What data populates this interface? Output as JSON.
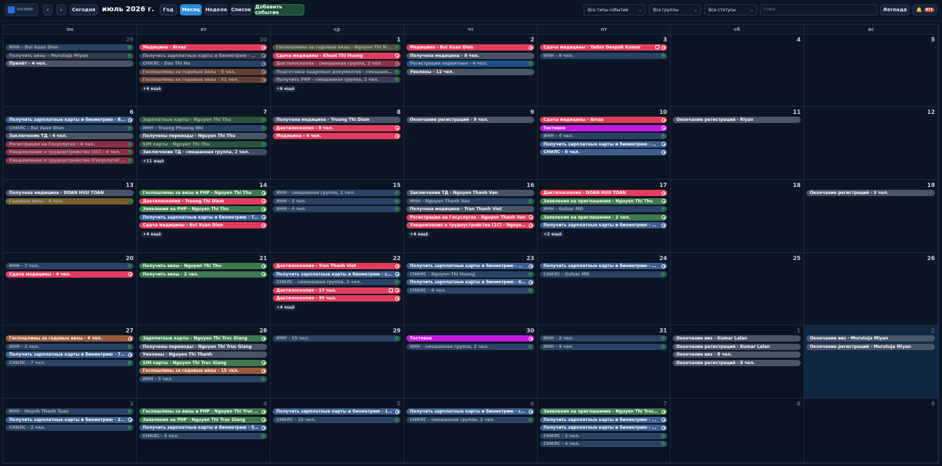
{
  "toolbar": {
    "logo_text": "DVCRMM",
    "prev_label": "‹",
    "next_label": "›",
    "today_label": "Сегодня",
    "title": "июль 2026 г.",
    "views": [
      "Год",
      "Месяц",
      "Неделя",
      "Список"
    ],
    "active_view": "Месяц",
    "add_event_label": "Добавить событие",
    "filter_types": "Все типы событий",
    "filter_groups": "Все группы",
    "filter_statuses": "Все статусы",
    "search_placeholder": "Поиск",
    "legend_label": "Легенда",
    "notifications_count": "471"
  },
  "weekdays": [
    "пн",
    "вт",
    "ср",
    "чт",
    "пт",
    "сб",
    "вс"
  ],
  "colors": {
    "background": "#0b1524",
    "today": "#102744",
    "accent_active": "#2e8bd8",
    "add_button": "#1e4d3a"
  },
  "weeks": [
    [
      {
        "day": "29",
        "other": true,
        "events": [
          {
            "t": "ИНН – Bui Xuan Dien",
            "c": "blue",
            "s": "ok",
            "dim": true
          },
          {
            "t": "Получить визы – Murutuja Miyan",
            "c": "gray",
            "s": "ok",
            "dim": true
          },
          {
            "t": "Прилёт - 4 чел.",
            "c": "gray",
            "s": ""
          }
        ]
      },
      {
        "day": "30",
        "other": true,
        "events": [
          {
            "t": "Медицина - Arvaz",
            "c": "red",
            "s": "pend"
          },
          {
            "t": "Получить зарплатные карты и биометрию - Dao ...",
            "c": "gray",
            "s": "pend",
            "dim": true
          },
          {
            "t": "СНИЛС - Dao Thi Ha",
            "c": "blue",
            "s": "pend",
            "dim": true
          },
          {
            "t": "Госпошлины за годовые визы - 5 чел.",
            "c": "brown",
            "s": "pend",
            "dim": true
          },
          {
            "t": "Госпошлины за годовые визы - 51 чел.",
            "c": "brown",
            "s": "pend",
            "dim": true
          }
        ],
        "more": "+4 ещё"
      },
      {
        "day": "1",
        "events": [
          {
            "t": "Госпошлины за годовые визы - Nguyen Thi Nhai",
            "c": "olive",
            "s": "ok",
            "dim": true
          },
          {
            "t": "Сдача медицины - Khuat Thi Huong",
            "c": "red",
            "s": "pend"
          },
          {
            "t": "Дактилоскопия - смешанная группа, 2 чел.",
            "c": "red",
            "s": "pend",
            "dim": true
          },
          {
            "t": "Подготовка кадровых документов - смешанная...",
            "c": "gray",
            "s": "ok",
            "dim": true
          },
          {
            "t": "Получить РНР - смешанная группа, 2 чел.",
            "c": "plum",
            "s": "ok",
            "dim": true
          }
        ],
        "more": "+6 ещё"
      },
      {
        "day": "2",
        "events": [
          {
            "t": "Медицина - Bui Xuan Dien",
            "c": "red",
            "s": "pend"
          },
          {
            "t": "Получена медицина - 8 чел.",
            "c": "gray",
            "s": ""
          },
          {
            "t": "Регистрация первичная - 4 чел.",
            "c": "lblue",
            "s": "ok",
            "dim": true
          },
          {
            "t": "Уволены - 12 чел.",
            "c": "gray",
            "s": ""
          }
        ]
      },
      {
        "day": "3",
        "events": [
          {
            "t": "Сдача медицины - Yadav Deepak Kumar",
            "c": "red",
            "s": "pend",
            "sq": true
          },
          {
            "t": "ИНН - 8 чел.",
            "c": "blue",
            "s": "ok",
            "dim": true
          }
        ]
      },
      {
        "day": "4",
        "events": []
      },
      {
        "day": "5",
        "events": []
      }
    ],
    [
      {
        "day": "6",
        "events": [
          {
            "t": "Получить зарплатные карты и биометрию - Bui ...",
            "c": "blue",
            "s": "pend"
          },
          {
            "t": "СНИЛС - Bui Xuan Dien",
            "c": "blue",
            "s": "ok",
            "dim": true
          },
          {
            "t": "Заключение ТД - 4 чел.",
            "c": "gray",
            "s": ""
          },
          {
            "t": "Регистрация на Госуслугах - 4 чел.",
            "c": "red",
            "s": "ok",
            "dim": true
          },
          {
            "t": "Уведомление о трудоустройстве (1С) - 4 чел.",
            "c": "red",
            "s": "ok",
            "dim": true
          },
          {
            "t": "Уведомление о трудоустройстве (Госуслуги) - 4 ...",
            "c": "red",
            "s": "ok",
            "dim": true
          }
        ]
      },
      {
        "day": "7",
        "events": [
          {
            "t": "Зарплатные карты - Nguyen Thi Thu",
            "c": "green",
            "s": "ok",
            "dim": true
          },
          {
            "t": "ИНН - Truong Phuong Nhi",
            "c": "blue",
            "s": "ok",
            "dim": true
          },
          {
            "t": "Получены переводы - Nguyen Thi Thu",
            "c": "gray",
            "s": ""
          },
          {
            "t": "SIM карты - Nguyen Thi Thu",
            "c": "green",
            "s": "ok",
            "dim": true
          },
          {
            "t": "Заключение ТД - смешанная группа, 2 чел.",
            "c": "slate",
            "s": ""
          }
        ],
        "more": "+11 ещё"
      },
      {
        "day": "8",
        "events": [
          {
            "t": "Получена медицина - Truong Thi Diem",
            "c": "gray",
            "s": ""
          },
          {
            "t": "Дактилоскопия - 8 чел.",
            "c": "red",
            "s": "pend"
          },
          {
            "t": "Медицина - 4 чел.",
            "c": "red",
            "s": "pend"
          }
        ]
      },
      {
        "day": "9",
        "events": [
          {
            "t": "Окончание регистраций - 9 чел.",
            "c": "gray",
            "s": ""
          }
        ]
      },
      {
        "day": "10",
        "events": [
          {
            "t": "Сдача медицины - Arvaz",
            "c": "red",
            "s": "pend"
          },
          {
            "t": "Тестовое",
            "c": "purple",
            "s": "pend"
          },
          {
            "t": "ИНН - 4 чел.",
            "c": "blue",
            "s": "ok",
            "dim": true
          },
          {
            "t": "Получить зарплатные карты и биометрию - 8 чел.",
            "c": "blue",
            "s": "pend"
          },
          {
            "t": "СНИЛС - 8 чел.",
            "c": "blue",
            "s": "pend"
          }
        ]
      },
      {
        "day": "11",
        "events": [
          {
            "t": "Окончание регистраций - Riyan",
            "c": "gray",
            "s": ""
          }
        ]
      },
      {
        "day": "12",
        "events": []
      }
    ],
    [
      {
        "day": "13",
        "events": [
          {
            "t": "Получена медицина - DOAN HUU TOAN",
            "c": "gray",
            "s": ""
          },
          {
            "t": "Годовые визы - 4 чел.",
            "c": "amber",
            "s": "ok",
            "dim": true
          }
        ]
      },
      {
        "day": "14",
        "events": [
          {
            "t": "Госпошлины за визы и РНР - Nguyen Thi Thu",
            "c": "green",
            "s": "pend"
          },
          {
            "t": "Дактилоскопия - Truong Thi Diem",
            "c": "red",
            "s": "pend"
          },
          {
            "t": "Заявления на РНР - Nguyen Thi Thu",
            "c": "green",
            "s": "pend"
          },
          {
            "t": "Получить зарплатные карты и биометрию - Truo...",
            "c": "blue",
            "s": "pend"
          },
          {
            "t": "Сдача медицины - Bui Xuan Dien",
            "c": "red",
            "s": "pend"
          }
        ],
        "more": "+4 ещё"
      },
      {
        "day": "15",
        "events": [
          {
            "t": "ИНН - смешанная группа, 2 чел.",
            "c": "blue",
            "s": "ok",
            "dim": true
          },
          {
            "t": "ИНН - 3 чел.",
            "c": "blue",
            "s": "ok",
            "dim": true
          },
          {
            "t": "ИНН - 4 чел.",
            "c": "blue",
            "s": "ok",
            "dim": true
          }
        ]
      },
      {
        "day": "16",
        "events": [
          {
            "t": "Заключение ТД - Nguyen Thanh Van",
            "c": "gray",
            "s": ""
          },
          {
            "t": "ИНН - Nguyen Thanh Van",
            "c": "blue",
            "s": "ok",
            "dim": true
          },
          {
            "t": "Получена медицина - Tran Thanh Viet",
            "c": "gray",
            "s": ""
          },
          {
            "t": "Регистрация на Госуслугах - Nguyen Thanh Van",
            "c": "red",
            "s": "pend"
          },
          {
            "t": "Уведомления о трудоустройстве (1С) - Nguyen T...",
            "c": "red",
            "s": "pend"
          }
        ],
        "more": "+4 ещё"
      },
      {
        "day": "17",
        "events": [
          {
            "t": "Дактилоскопия - DOAN HUU TOAN",
            "c": "red",
            "s": "pend"
          },
          {
            "t": "Заявления на приглашения - Nguyen Thi Thu",
            "c": "green",
            "s": "pend"
          },
          {
            "t": "ИНН - Gulzar MD",
            "c": "blue",
            "s": "ok",
            "dim": true
          },
          {
            "t": "Заявления на приглашения - 2 чел.",
            "c": "green",
            "s": "pend"
          },
          {
            "t": "Получить зарплатные карты и биометрию - 4 чел.",
            "c": "blue",
            "s": "pend"
          }
        ],
        "more": "+2 ещё"
      },
      {
        "day": "18",
        "events": []
      },
      {
        "day": "19",
        "events": [
          {
            "t": "Окончание регистраций - 3 чел.",
            "c": "gray",
            "s": ""
          }
        ]
      }
    ],
    [
      {
        "day": "20",
        "events": [
          {
            "t": "ИНН - 7 чел.",
            "c": "blue",
            "s": "ok",
            "dim": true
          },
          {
            "t": "Сдача медицины - 4 чел.",
            "c": "red",
            "s": "pend"
          }
        ]
      },
      {
        "day": "21",
        "events": [
          {
            "t": "Получить визы - Nguyen Thi Thu",
            "c": "green",
            "s": "pend"
          },
          {
            "t": "Получить визы - 2 чел.",
            "c": "green",
            "s": "pend"
          }
        ]
      },
      {
        "day": "22",
        "events": [
          {
            "t": "Дактилоскопия - Tran Thanh Viet",
            "c": "red",
            "s": "pend"
          },
          {
            "t": "Получить зарплатные карты и биометрию - см...",
            "c": "blue",
            "s": "pend"
          },
          {
            "t": "СНИЛС - смешанная группа, 2 чел.",
            "c": "blue",
            "s": "ok",
            "dim": true
          },
          {
            "t": "Дактилоскопия - 17 чел.",
            "c": "red",
            "s": "pend",
            "sq": true
          },
          {
            "t": "Дактилоскопия - 35 чел.",
            "c": "red",
            "s": "pend"
          }
        ],
        "more": "+4 ещё"
      },
      {
        "day": "23",
        "events": [
          {
            "t": "Получить зарплатные карты и биометрию - Ngu...",
            "c": "blue",
            "s": "pend"
          },
          {
            "t": "СНИЛС - Nguyen Thi Huong",
            "c": "blue",
            "s": "ok",
            "dim": true
          },
          {
            "t": "Получить зарплатные карты и биометрию - 6 чел.",
            "c": "blue",
            "s": "pend"
          },
          {
            "t": "СНИЛС - 6 чел.",
            "c": "blue",
            "s": "ok",
            "dim": true
          }
        ]
      },
      {
        "day": "24",
        "events": [
          {
            "t": "Получить зарплатные карты и биометрию - Gulz...",
            "c": "blue",
            "s": "pend"
          },
          {
            "t": "СНИЛС - Gulzar MD",
            "c": "blue",
            "s": "ok",
            "dim": true
          }
        ]
      },
      {
        "day": "25",
        "events": []
      },
      {
        "day": "26",
        "events": []
      }
    ],
    [
      {
        "day": "27",
        "events": [
          {
            "t": "Госпошлины за годовые визы - 4 чел.",
            "c": "brown",
            "s": "pend"
          },
          {
            "t": "ИНН - 2 чел.",
            "c": "blue",
            "s": "ok",
            "dim": true
          },
          {
            "t": "Получить зарплатные карты и биометрию - 7 чел.",
            "c": "blue",
            "s": "pend"
          },
          {
            "t": "СНИЛС - 7 чел.",
            "c": "blue",
            "s": "ok",
            "dim": true
          }
        ]
      },
      {
        "day": "28",
        "events": [
          {
            "t": "Зарплатные карты - Nguyen Thi Truc Giang",
            "c": "green",
            "s": "pend"
          },
          {
            "t": "Получены переводы - Nguyen Thi Truc Giang",
            "c": "gray",
            "s": ""
          },
          {
            "t": "Уволены - Nguyen Thi Thanh",
            "c": "gray",
            "s": ""
          },
          {
            "t": "SIM карты - Nguyen Thi Truc Giang",
            "c": "green",
            "s": "pend"
          },
          {
            "t": "Госпошлины за годовые визы - 15 чел.",
            "c": "brown",
            "s": "pend"
          },
          {
            "t": "ИНН - 5 чел.",
            "c": "blue",
            "s": "ok",
            "dim": true
          }
        ]
      },
      {
        "day": "29",
        "events": [
          {
            "t": "ИНН - 15 чел.",
            "c": "blue",
            "s": "ok",
            "dim": true
          }
        ]
      },
      {
        "day": "30",
        "events": [
          {
            "t": "Тестовое",
            "c": "purple",
            "s": "pend"
          },
          {
            "t": "ИНН - смешанная группа, 2 чел.",
            "c": "blue",
            "s": "ok",
            "dim": true
          }
        ]
      },
      {
        "day": "31",
        "events": [
          {
            "t": "ИНН - 2 чел.",
            "c": "blue",
            "s": "ok",
            "dim": true
          },
          {
            "t": "ИНН - 4 чел.",
            "c": "blue",
            "s": "ok",
            "dim": true
          }
        ]
      },
      {
        "day": "1",
        "other": true,
        "events": [
          {
            "t": "Окончание виз - Kumar Lalan",
            "c": "gray",
            "s": ""
          },
          {
            "t": "Окончание регистраций - Kumar Lalan",
            "c": "gray",
            "s": ""
          },
          {
            "t": "Окончание виз - 8 чел.",
            "c": "gray",
            "s": ""
          },
          {
            "t": "Окончание регистраций - 8 чел.",
            "c": "gray",
            "s": ""
          }
        ]
      },
      {
        "day": "2",
        "other": true,
        "today": true,
        "events": [
          {
            "t": "Окончание виз - Murutuja Miyan",
            "c": "gray",
            "s": ""
          },
          {
            "t": "Окончание регистраций - Murutuja Miyan",
            "c": "gray",
            "s": ""
          }
        ]
      }
    ],
    [
      {
        "day": "3",
        "other": true,
        "events": [
          {
            "t": "ИНН - Huynh Thanh Tuan",
            "c": "blue",
            "s": "ok",
            "dim": true
          },
          {
            "t": "Получить зарплатные карты и биометрию - 2 чел.",
            "c": "blue",
            "s": "pend"
          },
          {
            "t": "СНИЛС - 2 чел.",
            "c": "blue",
            "s": "ok",
            "dim": true
          }
        ]
      },
      {
        "day": "4",
        "other": true,
        "events": [
          {
            "t": "Госпошлины за визы и РНР - Nguyen Thi Truc Gi...",
            "c": "green",
            "s": "pend"
          },
          {
            "t": "Заявления на РНР - Nguyen Thi Truc Giang",
            "c": "green",
            "s": "pend"
          },
          {
            "t": "Получить зарплатные карты и биометрию - 5 чел.",
            "c": "blue",
            "s": "pend"
          },
          {
            "t": "СНИЛС - 5 чел.",
            "c": "blue",
            "s": "ok",
            "dim": true
          }
        ]
      },
      {
        "day": "5",
        "other": true,
        "events": [
          {
            "t": "Получить зарплатные карты и биометрию - 15 ...",
            "c": "blue",
            "s": "pend"
          },
          {
            "t": "СНИЛС - 15 чел.",
            "c": "blue",
            "s": "ok",
            "dim": true
          }
        ]
      },
      {
        "day": "6",
        "other": true,
        "events": [
          {
            "t": "Получить зарплатные карты и биометрию - см...",
            "c": "blue",
            "s": "pend"
          },
          {
            "t": "СНИЛС - смешанная группа, 2 чел.",
            "c": "blue",
            "s": "ok",
            "dim": true
          }
        ]
      },
      {
        "day": "7",
        "other": true,
        "events": [
          {
            "t": "Заявления на приглашения - Nguyen Thi Truc Gia...",
            "c": "green",
            "s": "pend"
          },
          {
            "t": "Получить зарплатные карты и биометрию - 2 чел.",
            "c": "blue",
            "s": "pend"
          },
          {
            "t": "Получить зарплатные карты и биометрию - 4 чел.",
            "c": "blue",
            "s": "pend"
          },
          {
            "t": "СНИЛС - 2 чел.",
            "c": "blue",
            "s": "ok",
            "dim": true
          },
          {
            "t": "СНИЛС - 4 чел.",
            "c": "blue",
            "s": "ok",
            "dim": true
          }
        ]
      },
      {
        "day": "8",
        "other": true,
        "events": []
      },
      {
        "day": "9",
        "other": true,
        "events": []
      }
    ]
  ]
}
